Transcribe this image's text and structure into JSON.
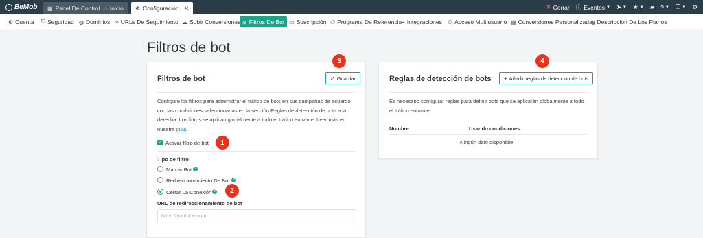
{
  "topbar": {
    "logo": "BeMob",
    "tabs": [
      {
        "label": "Panel De Control",
        "icon": "dashboard-icon"
      },
      {
        "label": "Inicio",
        "icon": "home-icon"
      },
      {
        "label": "Configuración",
        "icon": "gear-icon",
        "active": true
      }
    ],
    "close_label": "Cerrar",
    "events_label": "Eventos"
  },
  "nav": {
    "items": [
      {
        "label": "Cuenta",
        "icon": "gear-icon"
      },
      {
        "label": "Seguridad",
        "icon": "shield-icon"
      },
      {
        "label": "Dominios",
        "icon": "globe-icon"
      },
      {
        "label": "URLs De Seguimiento",
        "icon": "link-icon"
      },
      {
        "label": "Subir Conversiones",
        "icon": "cloud-upload-icon"
      },
      {
        "label": "Filtros De Bot",
        "icon": "ban-icon",
        "active": true
      },
      {
        "label": "Suscripción",
        "icon": "card-icon"
      },
      {
        "label": "Programa De Referencia",
        "icon": "users-icon"
      },
      {
        "label": "Integraciones",
        "icon": "plug-icon"
      },
      {
        "label": "Acceso Multiusuario",
        "icon": "users-icon"
      },
      {
        "label": "Conversiones Personalizadas",
        "icon": "list-icon"
      },
      {
        "label": "Descripción De Los Planos",
        "icon": "document-icon"
      }
    ]
  },
  "page": {
    "title": "Filtros de bot"
  },
  "filters_card": {
    "title": "Filtros de bot",
    "save_label": "Guardar",
    "description_before_link": "Configure los filtros para administrar el tráfico de bots en sus campañas de acuerdo con las condiciones seleccionadas en la sección Reglas de detección de bots a la derecha. Los filtros se aplican globalmente a todo el tráfico entrante. Leer más en nuestra ",
    "description_link": "guía",
    "description_after_link": ".",
    "enable_label": "Activar filtro de bot",
    "filter_type_label": "Tipo de filtro",
    "options": [
      "Marcar Bot",
      "Redireccionamiento De Bot",
      "Cerrar La Conexión"
    ],
    "selected_option": "Cerrar La Conexión",
    "redirect_url_label": "URL de redireccionamiento de bot",
    "redirect_url_placeholder": "https://youtube.com"
  },
  "rules_card": {
    "title": "Reglas de detección de bots",
    "add_label": "Añadir reglas de detección de bots",
    "description": "Es necesario configurar reglas para definir bots que se aplicarán globalmente a todo el tráfico entrante.",
    "columns": [
      "Nombre",
      "Usando condiciones"
    ],
    "empty_text": "Ningún dato disponible"
  },
  "badges": [
    "1",
    "2",
    "3",
    "4"
  ],
  "colors": {
    "accent": "#1aa58a",
    "topbar": "#2b3d48",
    "badge": "#e8321c",
    "link": "#1a73c8"
  }
}
